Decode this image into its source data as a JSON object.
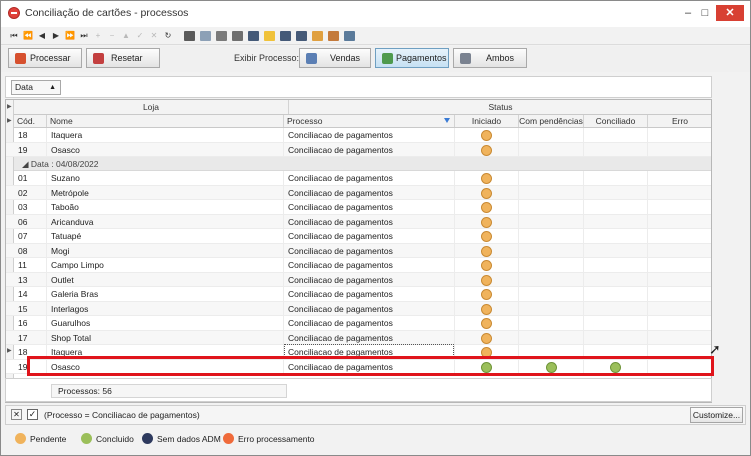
{
  "window": {
    "title": "Conciliação de cartões - processos",
    "minimize": "–",
    "maximize": "□",
    "close": "✕"
  },
  "navbar": [
    {
      "name": "first-record-icon",
      "glyph": "⏮",
      "disabled": false
    },
    {
      "name": "prev-page-icon",
      "glyph": "⏪",
      "disabled": false
    },
    {
      "name": "prev-record-icon",
      "glyph": "◀",
      "disabled": false
    },
    {
      "name": "next-record-icon",
      "glyph": "▶",
      "disabled": false
    },
    {
      "name": "next-page-icon",
      "glyph": "⏩",
      "disabled": false
    },
    {
      "name": "last-record-icon",
      "glyph": "⏭",
      "disabled": false
    },
    {
      "name": "insert-icon",
      "glyph": "+",
      "disabled": true
    },
    {
      "name": "delete-icon",
      "glyph": "−",
      "disabled": true
    },
    {
      "name": "edit-icon",
      "glyph": "▲",
      "disabled": true
    },
    {
      "name": "post-icon",
      "glyph": "✓",
      "disabled": true
    },
    {
      "name": "cancel-icon",
      "glyph": "✕",
      "disabled": true
    },
    {
      "name": "refresh-icon",
      "glyph": "↻",
      "disabled": false
    }
  ],
  "toolbar_icons": [
    {
      "name": "export-icon",
      "color": "#5a5a5a"
    },
    {
      "name": "document-icon",
      "color": "#8ca0b6"
    },
    {
      "name": "print-icon",
      "color": "#7a7a7a"
    },
    {
      "name": "print-preview-icon",
      "color": "#6f6f6f"
    },
    {
      "name": "search-icon",
      "color": "#455a78"
    },
    {
      "name": "folder-icon",
      "color": "#f0c23a"
    },
    {
      "name": "zoom-in-icon",
      "color": "#455a78"
    },
    {
      "name": "zoom-out-icon",
      "color": "#455a78"
    },
    {
      "name": "grid-layout-icon",
      "color": "#e0a040"
    },
    {
      "name": "report-icon",
      "color": "#c47a3c"
    },
    {
      "name": "filter-icon",
      "color": "#5a7a9a"
    }
  ],
  "actions": {
    "process": "Processar",
    "reset": "Resetar",
    "exibir_label": "Exibir Processo:",
    "vendas": "Vendas",
    "pagamentos": "Pagamentos",
    "ambos": "Ambos"
  },
  "group_chip": "Data",
  "columns": {
    "loja_band": "Loja",
    "status_band": "Status",
    "cod": "Cód.",
    "nome": "Nome",
    "processo": "Processo",
    "iniciado": "Iniciado",
    "com_pendencias": "Com pendências",
    "conciliado": "Conciliado",
    "erro": "Erro"
  },
  "group_row": "Data : 04/08/2022",
  "rows_before": [
    {
      "cod": "18",
      "nome": "Itaquera",
      "processo": "Conciliacao de pagamentos",
      "iniciado": "pendente",
      "pend": "",
      "conc": ""
    },
    {
      "cod": "19",
      "nome": "Osasco",
      "processo": "Conciliacao de pagamentos",
      "iniciado": "pendente",
      "pend": "",
      "conc": ""
    }
  ],
  "rows_group": [
    {
      "cod": "01",
      "nome": "Suzano",
      "processo": "Conciliacao de pagamentos",
      "iniciado": "pendente",
      "pend": "",
      "conc": ""
    },
    {
      "cod": "02",
      "nome": "Metrópole",
      "processo": "Conciliacao de pagamentos",
      "iniciado": "pendente",
      "pend": "",
      "conc": ""
    },
    {
      "cod": "03",
      "nome": "Taboão",
      "processo": "Conciliacao de pagamentos",
      "iniciado": "pendente",
      "pend": "",
      "conc": ""
    },
    {
      "cod": "06",
      "nome": "Aricanduva",
      "processo": "Conciliacao de pagamentos",
      "iniciado": "pendente",
      "pend": "",
      "conc": ""
    },
    {
      "cod": "07",
      "nome": "Tatuapé",
      "processo": "Conciliacao de pagamentos",
      "iniciado": "pendente",
      "pend": "",
      "conc": ""
    },
    {
      "cod": "08",
      "nome": "Mogi",
      "processo": "Conciliacao de pagamentos",
      "iniciado": "pendente",
      "pend": "",
      "conc": ""
    },
    {
      "cod": "11",
      "nome": "Campo Limpo",
      "processo": "Conciliacao de pagamentos",
      "iniciado": "pendente",
      "pend": "",
      "conc": ""
    },
    {
      "cod": "13",
      "nome": "Outlet",
      "processo": "Conciliacao de pagamentos",
      "iniciado": "pendente",
      "pend": "",
      "conc": ""
    },
    {
      "cod": "14",
      "nome": "Galeria Bras",
      "processo": "Conciliacao de pagamentos",
      "iniciado": "pendente",
      "pend": "",
      "conc": ""
    },
    {
      "cod": "15",
      "nome": "Interlagos",
      "processo": "Conciliacao de pagamentos",
      "iniciado": "pendente",
      "pend": "",
      "conc": ""
    },
    {
      "cod": "16",
      "nome": "Guarulhos",
      "processo": "Conciliacao de pagamentos",
      "iniciado": "pendente",
      "pend": "",
      "conc": ""
    },
    {
      "cod": "17",
      "nome": "Shop Total",
      "processo": "Conciliacao de pagamentos",
      "iniciado": "pendente",
      "pend": "",
      "conc": ""
    },
    {
      "cod": "18",
      "nome": "Itaquera",
      "processo": "Conciliacao de pagamentos",
      "iniciado": "pendente",
      "pend": "",
      "conc": ""
    },
    {
      "cod": "19",
      "nome": "Osasco",
      "processo": "Conciliacao de pagamentos",
      "iniciado": "concluido",
      "pend": "concluido",
      "conc": "concluido"
    }
  ],
  "footer": {
    "processos": "Processos: 56"
  },
  "filterbar": {
    "close": "✕",
    "check": "✓",
    "text": "(Processo  = Conciliacao de pagamentos)",
    "customize": "Customize..."
  },
  "legend": [
    {
      "label": "Pendente",
      "color": "#f0b35c"
    },
    {
      "label": "Concluido",
      "color": "#9bbf5a"
    },
    {
      "label": "Sem dados ADM",
      "color": "#2e3a5e"
    },
    {
      "label": "Erro processamento",
      "color": "#ef6a3a"
    }
  ],
  "colors": {
    "pendente": "#f0b35c",
    "concluido": "#9bbf5a",
    "highlight": "#e0141b",
    "active_button": "#c6e1f3"
  }
}
